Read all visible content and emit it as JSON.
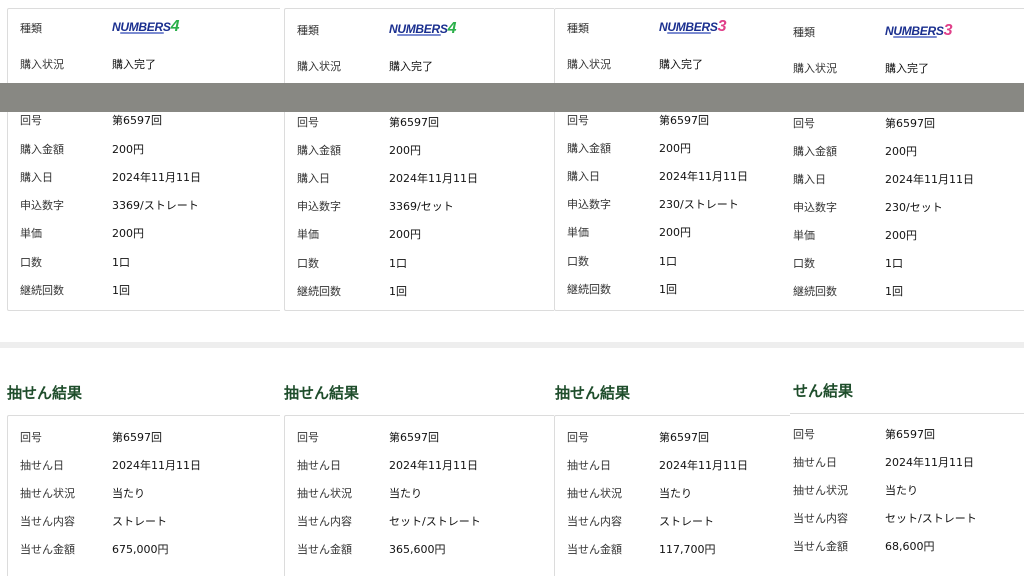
{
  "colors": {
    "section_title": "#1e4d2b",
    "overlay": "#888883",
    "numbers4_digit": "#2bb04a",
    "numbers3_digit": "#e0408a",
    "logo_word": "#1a2f8f"
  },
  "purchase_labels": {
    "kind": "種類",
    "status": "購入状況",
    "round": "回号",
    "amount": "購入金額",
    "date": "購入日",
    "numbers": "申込数字",
    "unit_price": "単価",
    "units": "口数",
    "continuation": "継続回数"
  },
  "result_labels": {
    "round": "回号",
    "draw_date": "抽せん日",
    "draw_status": "抽せん状況",
    "content": "当せん内容",
    "prize": "当せん金額"
  },
  "section_title": "抽せん結果",
  "section_title_clipped": "せん結果",
  "panels": [
    {
      "logo": {
        "word": "NUMBERS",
        "digit": "4",
        "icon": "numbers4-logo"
      },
      "purchase": {
        "status": "購入完了",
        "round": "第6597回",
        "amount": "200円",
        "date": "2024年11月11日",
        "numbers": "3369/ストレート",
        "unit_price": "200円",
        "units": "1口",
        "continuation": "1回"
      },
      "result": {
        "round": "第6597回",
        "draw_date": "2024年11月11日",
        "draw_status": "当たり",
        "content": "ストレート",
        "prize": "675,000円"
      }
    },
    {
      "logo": {
        "word": "NUMBERS",
        "digit": "4",
        "icon": "numbers4-logo"
      },
      "purchase": {
        "status": "購入完了",
        "round": "第6597回",
        "amount": "200円",
        "date": "2024年11月11日",
        "numbers": "3369/セット",
        "unit_price": "200円",
        "units": "1口",
        "continuation": "1回"
      },
      "result": {
        "round": "第6597回",
        "draw_date": "2024年11月11日",
        "draw_status": "当たり",
        "content": "セット/ストレート",
        "prize": "365,600円"
      }
    },
    {
      "logo": {
        "word": "NUMBERS",
        "digit": "3",
        "icon": "numbers3-logo"
      },
      "purchase": {
        "status": "購入完了",
        "round": "第6597回",
        "amount": "200円",
        "date": "2024年11月11日",
        "numbers": "230/ストレート",
        "unit_price": "200円",
        "units": "1口",
        "continuation": "1回"
      },
      "result": {
        "round": "第6597回",
        "draw_date": "2024年11月11日",
        "draw_status": "当たり",
        "content": "ストレート",
        "prize": "117,700円"
      }
    },
    {
      "logo": {
        "word": "NUMBERS",
        "digit": "3",
        "icon": "numbers3-logo"
      },
      "purchase": {
        "status": "購入完了",
        "round": "第6597回",
        "amount": "200円",
        "date": "2024年11月11日",
        "numbers": "230/セット",
        "unit_price": "200円",
        "units": "1口",
        "continuation": "1回"
      },
      "result": {
        "round": "第6597回",
        "draw_date": "2024年11月11日",
        "draw_status": "当たり",
        "content": "セット/ストレート",
        "prize": "68,600円"
      }
    }
  ]
}
